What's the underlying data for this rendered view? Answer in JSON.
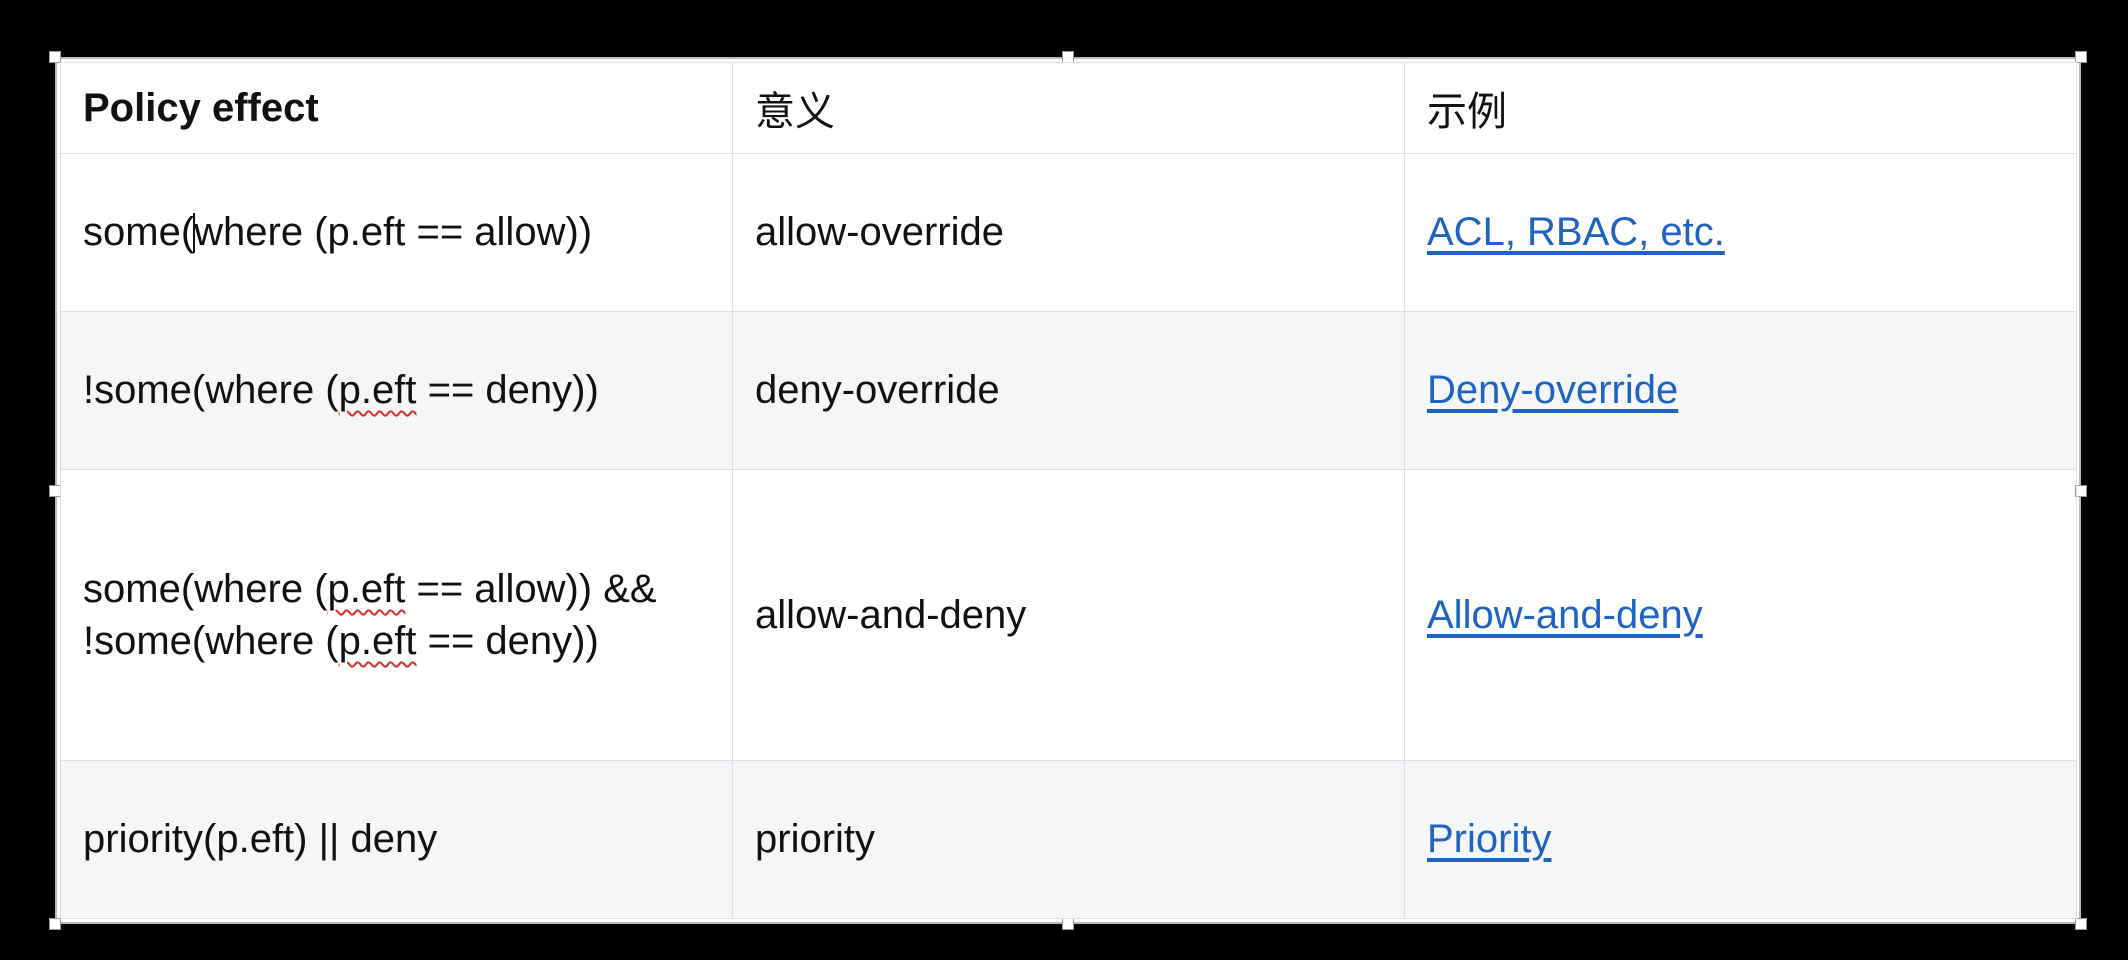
{
  "table": {
    "headers": [
      "Policy effect",
      "意义",
      "示例"
    ],
    "rows": [
      {
        "effect_before_caret": "some(",
        "effect_after_caret": "where (p.eft == allow))",
        "meaning": "allow-override",
        "example": "ACL, RBAC, etc."
      },
      {
        "effect_pre": "!some(where (",
        "effect_squiggle": "p.eft",
        "effect_post": " == deny))",
        "meaning": "deny-override",
        "example": "Deny-override"
      },
      {
        "line1_pre": "some(where (",
        "line1_squiggle": "p.eft",
        "line1_post": " == allow)) &&",
        "line2_pre": "!some(where (",
        "line2_squiggle": "p.eft",
        "line2_post": " == deny))",
        "meaning": "allow-and-deny",
        "example": "Allow-and-deny"
      },
      {
        "effect": "priority(p.eft) || deny",
        "meaning": "priority",
        "example": "Priority"
      }
    ]
  },
  "colors": {
    "link": "#1f63c1",
    "alt_row_bg": "#f5f6f8",
    "spellcheck": "#d62f2f"
  }
}
